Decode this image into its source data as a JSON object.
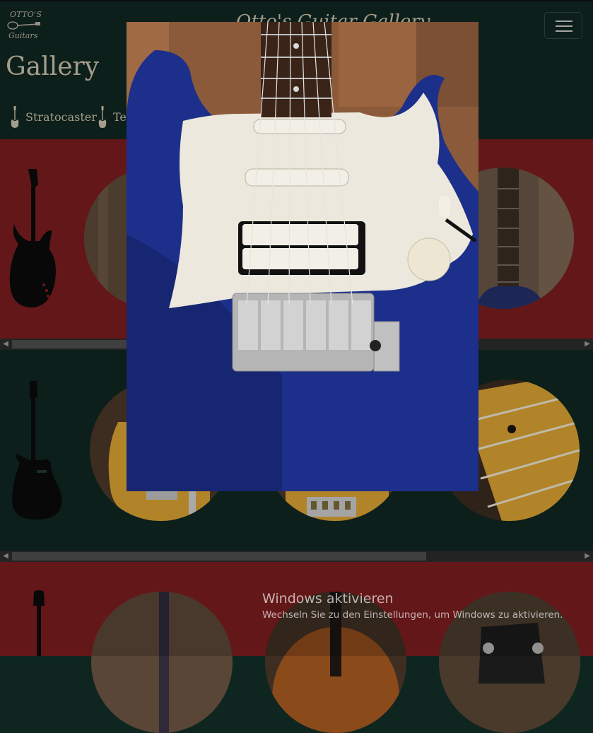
{
  "navbar": {
    "logo_line1": "OTTO'S",
    "logo_line2": "Guitars",
    "brand_text": "Otto's Guitar Gallery",
    "menu_icon": "hamburger-icon"
  },
  "page": {
    "title": "Gallery"
  },
  "tabs": [
    {
      "label": "Stratocaster",
      "icon": "guitar-icon"
    },
    {
      "label": "Telecaster",
      "icon": "guitar-icon"
    }
  ],
  "modal": {
    "description": "Blue stratocaster-style guitar close-up"
  },
  "watermark": {
    "title": "Windows aktivieren",
    "subtitle": "Wechseln Sie zu den Einstellungen, um Windows zu aktivieren."
  },
  "colors": {
    "red_band": "#7a1d1e",
    "dark_green": "#0f2620",
    "text_beige": "#c9c0aa"
  }
}
